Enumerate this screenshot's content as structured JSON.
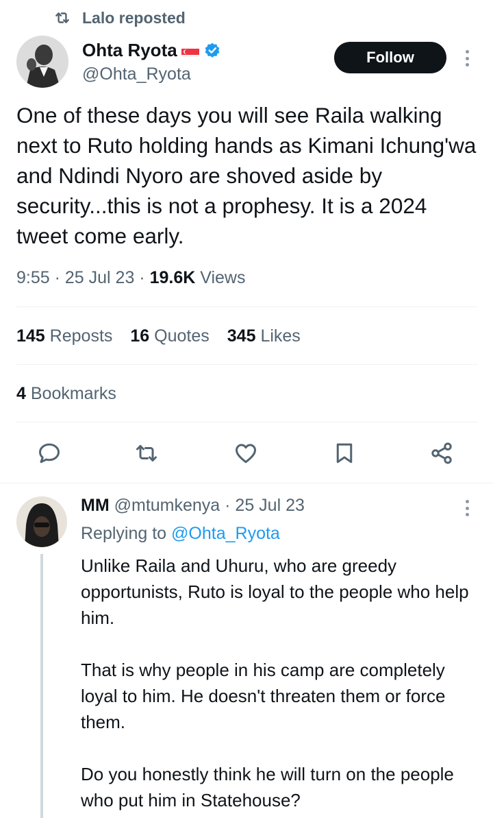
{
  "repost": {
    "icon": "repost-icon",
    "label": "Lalo reposted"
  },
  "author": {
    "name": "Ohta Ryota",
    "handle": "@Ohta_Ryota",
    "flag": "singapore-flag",
    "verified": "verified-badge-icon"
  },
  "follow_label": "Follow",
  "tweet": {
    "text": "One of these days you will see Raila walking next to Ruto holding hands as Kimani Ichung'wa and Ndindi Nyoro are shoved aside by security...this is not a prophesy. It is a 2024 tweet come early.",
    "time": "9:55",
    "date": "25 Jul 23",
    "views_count": "19.6K",
    "views_label": "Views"
  },
  "stats": {
    "reposts_count": "145",
    "reposts_label": "Reposts",
    "quotes_count": "16",
    "quotes_label": "Quotes",
    "likes_count": "345",
    "likes_label": "Likes",
    "bookmarks_count": "4",
    "bookmarks_label": "Bookmarks"
  },
  "actions": [
    "reply-icon",
    "repost-icon",
    "like-icon",
    "bookmark-icon",
    "share-icon"
  ],
  "reply": {
    "name": "MM",
    "handle": "@mtumkenya",
    "date": "25 Jul 23",
    "replying_prefix": "Replying to",
    "replying_to": "@Ohta_Ryota",
    "text": "Unlike Raila and Uhuru, who are greedy opportunists, Ruto is loyal to the people who help him.\n\nThat is why people in his camp are completely loyal to him. He doesn't threaten them or force them.\n\nDo you honestly think he will turn on the people who put him in Statehouse?"
  },
  "colors": {
    "accent": "#1d9bf0",
    "secondary_text": "#536471",
    "primary_text": "#0f1419",
    "divider": "#eff3f4"
  }
}
